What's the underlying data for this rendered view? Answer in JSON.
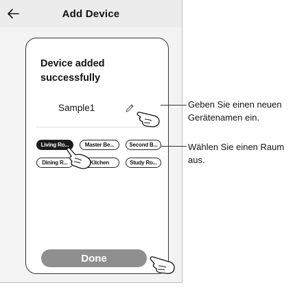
{
  "header": {
    "back_icon": "arrow-left-icon",
    "title": "Add Device"
  },
  "card": {
    "success_message": "Device added successfully",
    "device_name": "Sample1",
    "edit_icon": "pencil-icon",
    "rooms": [
      {
        "label": "Living Ro...",
        "selected": true
      },
      {
        "label": "Master Be...",
        "selected": false
      },
      {
        "label": "Second B...",
        "selected": false
      },
      {
        "label": "Dining R...",
        "selected": false
      },
      {
        "label": "Kitchen",
        "selected": false
      },
      {
        "label": "Study Ro...",
        "selected": false
      }
    ],
    "done_label": "Done"
  },
  "annotations": {
    "rename": "Geben Sie einen neuen Gerätenamen ein.",
    "room": "Wählen Sie einen Raum aus."
  },
  "colors": {
    "screen_bg": "#f3f3f3",
    "header_bg": "#ececec",
    "done_button": "#8f8f8f",
    "selected_room": "#1a1a1a"
  }
}
